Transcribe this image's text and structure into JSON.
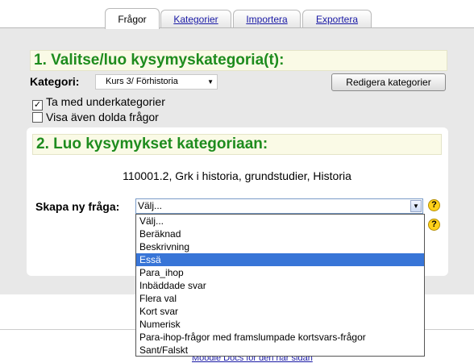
{
  "tabs": [
    {
      "label": "Frågor",
      "active": true
    },
    {
      "label": "Kategorier",
      "active": false
    },
    {
      "label": "Importera",
      "active": false
    },
    {
      "label": "Exportera",
      "active": false
    }
  ],
  "section1": {
    "heading": "1. Valitse/luo kysymyskategoria(t):",
    "category_label": "Kategori:",
    "category_selected": "Kurs 3/ Förhistoria",
    "edit_button": "Redigera kategorier",
    "include_subcategories": {
      "label": "Ta med underkategorier",
      "checked": true
    },
    "show_hidden": {
      "label": "Visa även dolda frågor",
      "checked": false
    }
  },
  "section2": {
    "heading": "2. Luo kysymykset kategoriaan:",
    "course_line": "110001.2, Grk i historia, grundstudier, Historia",
    "create_label": "Skapa ny fråga:",
    "create_selected": "Välj...",
    "options": [
      "Välj...",
      "Beräknad",
      "Beskrivning",
      "Essä",
      "Para_ihop",
      "Inbäddade svar",
      "Flera val",
      "Kort svar",
      "Numerisk",
      "Para-ihop-frågor med framslumpade kortsvars-frågor",
      "Sant/Falskt"
    ],
    "highlighted_option": "Essä"
  },
  "footer": {
    "partial_text": "Moodle Docs för den här sidan"
  },
  "icons": {
    "help": "help-icon",
    "dropdown": "chevron-down-icon",
    "check": "check-icon"
  },
  "colors": {
    "heading": "#1e8c1e",
    "heading_bg": "#fafae6",
    "highlight": "#3875d7",
    "link": "#1a1aa6"
  }
}
